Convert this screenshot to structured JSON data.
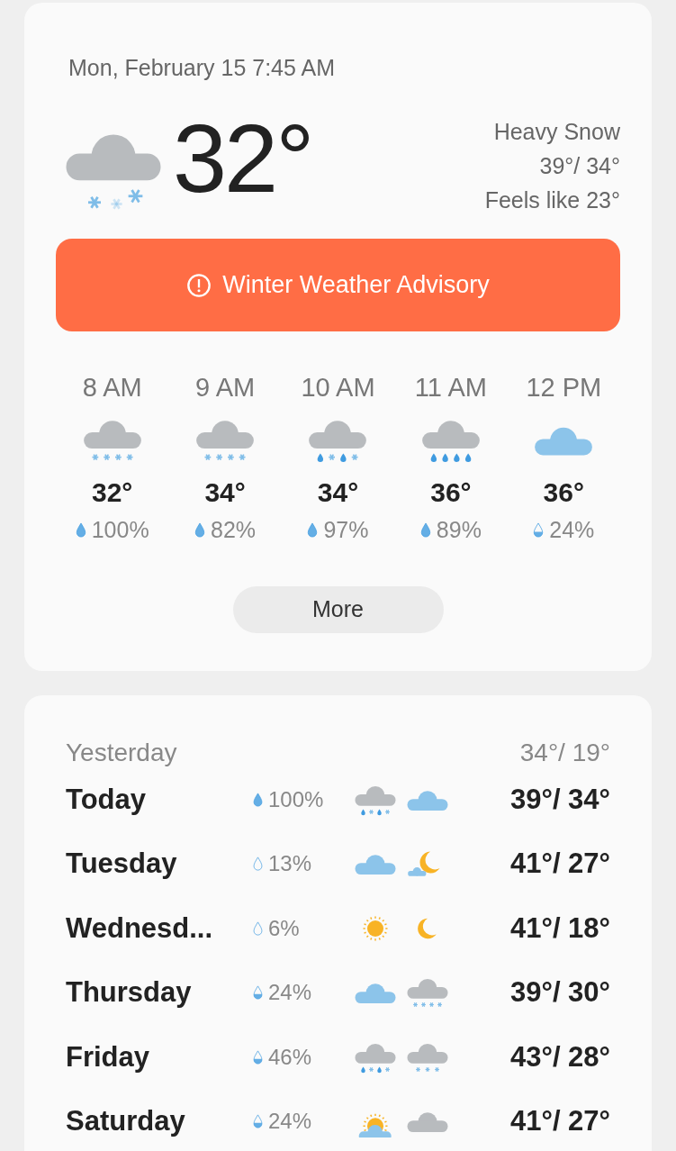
{
  "current": {
    "datetime": "Mon, February 15 7:45 AM",
    "icon": {
      "kind": "snow_main"
    },
    "temperature": "32°",
    "condition": "Heavy Snow",
    "high_low": "39°/ 34°",
    "feels_like": "Feels like 23°"
  },
  "alert": {
    "label": "Winter Weather Advisory"
  },
  "hourly": [
    {
      "time": "8 AM",
      "icon": {
        "kind": "snow"
      },
      "temperature": "32°",
      "drop": {
        "kind": "full"
      },
      "precip": "100%"
    },
    {
      "time": "9 AM",
      "icon": {
        "kind": "snow"
      },
      "temperature": "34°",
      "drop": {
        "kind": "full"
      },
      "precip": "82%"
    },
    {
      "time": "10 AM",
      "icon": {
        "kind": "mix"
      },
      "temperature": "34°",
      "drop": {
        "kind": "full"
      },
      "precip": "97%"
    },
    {
      "time": "11 AM",
      "icon": {
        "kind": "rain"
      },
      "temperature": "36°",
      "drop": {
        "kind": "full"
      },
      "precip": "89%"
    },
    {
      "time": "12 PM",
      "icon": {
        "kind": "cloudy"
      },
      "temperature": "36°",
      "drop": {
        "kind": "half"
      },
      "precip": "24%"
    }
  ],
  "more_button": "More",
  "yesterday": {
    "label": "Yesterday",
    "high_low": "34°/ 19°"
  },
  "daily": [
    {
      "day": "Today",
      "drop": {
        "kind": "full"
      },
      "precip": "100%",
      "day_icon": {
        "kind": "mix"
      },
      "night_icon": {
        "kind": "cloudy"
      },
      "high_low": "39°/ 34°"
    },
    {
      "day": "Tuesday",
      "drop": {
        "kind": "empty"
      },
      "precip": "13%",
      "day_icon": {
        "kind": "cloudy"
      },
      "night_icon": {
        "kind": "night_cloudy"
      },
      "high_low": "41°/ 27°"
    },
    {
      "day": "Wednesd...",
      "drop": {
        "kind": "empty"
      },
      "precip": "6%",
      "day_icon": {
        "kind": "sunny"
      },
      "night_icon": {
        "kind": "clear_night"
      },
      "high_low": "41°/ 18°"
    },
    {
      "day": "Thursday",
      "drop": {
        "kind": "half"
      },
      "precip": "24%",
      "day_icon": {
        "kind": "cloudy"
      },
      "night_icon": {
        "kind": "snow"
      },
      "high_low": "39°/ 30°"
    },
    {
      "day": "Friday",
      "drop": {
        "kind": "half"
      },
      "precip": "46%",
      "day_icon": {
        "kind": "mix"
      },
      "night_icon": {
        "kind": "light_snow"
      },
      "high_low": "43°/ 28°"
    },
    {
      "day": "Saturday",
      "drop": {
        "kind": "half"
      },
      "precip": "24%",
      "day_icon": {
        "kind": "sun_cloud"
      },
      "night_icon": {
        "kind": "overcast"
      },
      "high_low": "41°/ 27°"
    }
  ]
}
